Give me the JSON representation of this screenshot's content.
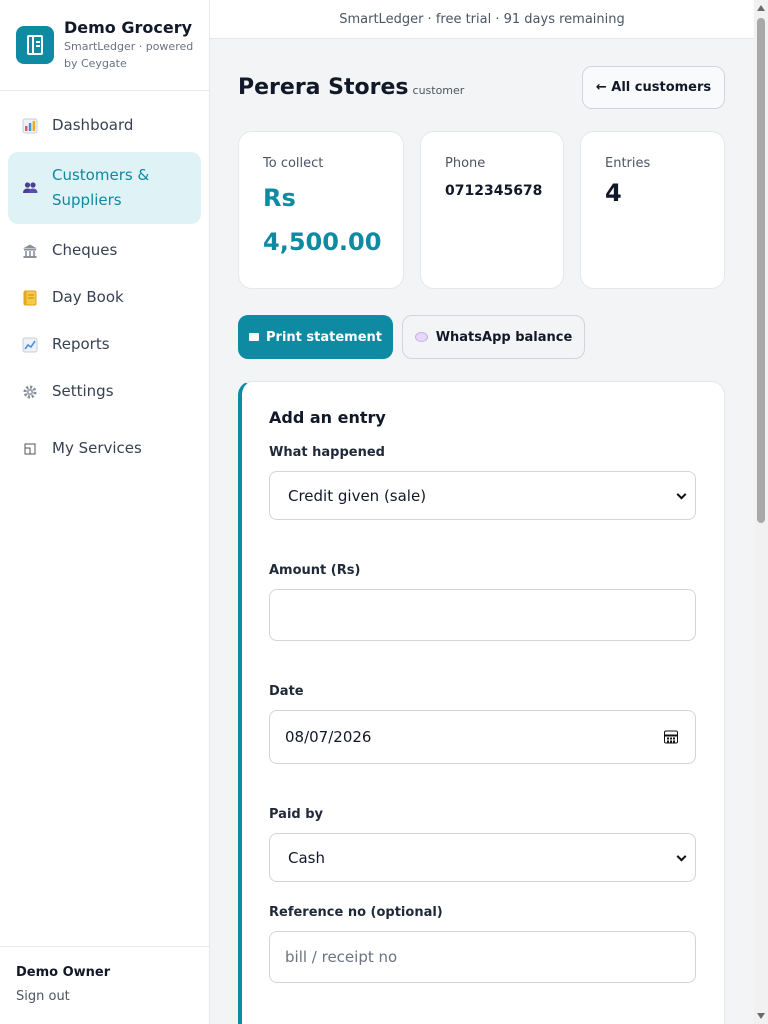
{
  "brand": {
    "name": "Demo Grocery",
    "subtitle": "SmartLedger · powered by Ceygate",
    "accent": "#0e8aa3"
  },
  "nav": {
    "items": [
      {
        "label": "Dashboard",
        "icon": "bar-chart-icon"
      },
      {
        "label": "Customers & Suppliers",
        "icon": "people-icon",
        "active": true
      },
      {
        "label": "Cheques",
        "icon": "bank-icon"
      },
      {
        "label": "Day Book",
        "icon": "notebook-icon"
      },
      {
        "label": "Reports",
        "icon": "line-chart-icon"
      },
      {
        "label": "Settings",
        "icon": "gear-icon"
      },
      {
        "label": "My Services",
        "icon": "window-icon"
      }
    ]
  },
  "user": {
    "name": "Demo Owner",
    "signout": "Sign out"
  },
  "topbar": {
    "trial_text": "SmartLedger · free trial · 91 days remaining"
  },
  "page": {
    "title": "Perera Stores",
    "tag": "customer",
    "back_label": "← All customers"
  },
  "stats": {
    "collect_label": "To collect",
    "collect_value": "Rs 4,500.00",
    "phone_label": "Phone",
    "phone_value": "0712345678",
    "entries_label": "Entries",
    "entries_value": "4"
  },
  "actions": {
    "print_label": "Print statement",
    "whatsapp_label": "WhatsApp balance"
  },
  "form": {
    "title": "Add an entry",
    "what_label": "What happened",
    "what_value": "Credit given (sale)",
    "amount_label": "Amount (Rs)",
    "amount_value": "",
    "date_label": "Date",
    "date_value": "08/07/2026",
    "paid_label": "Paid by",
    "paid_value": "Cash",
    "ref_label": "Reference no (optional)",
    "ref_placeholder": "bill / receipt no"
  }
}
